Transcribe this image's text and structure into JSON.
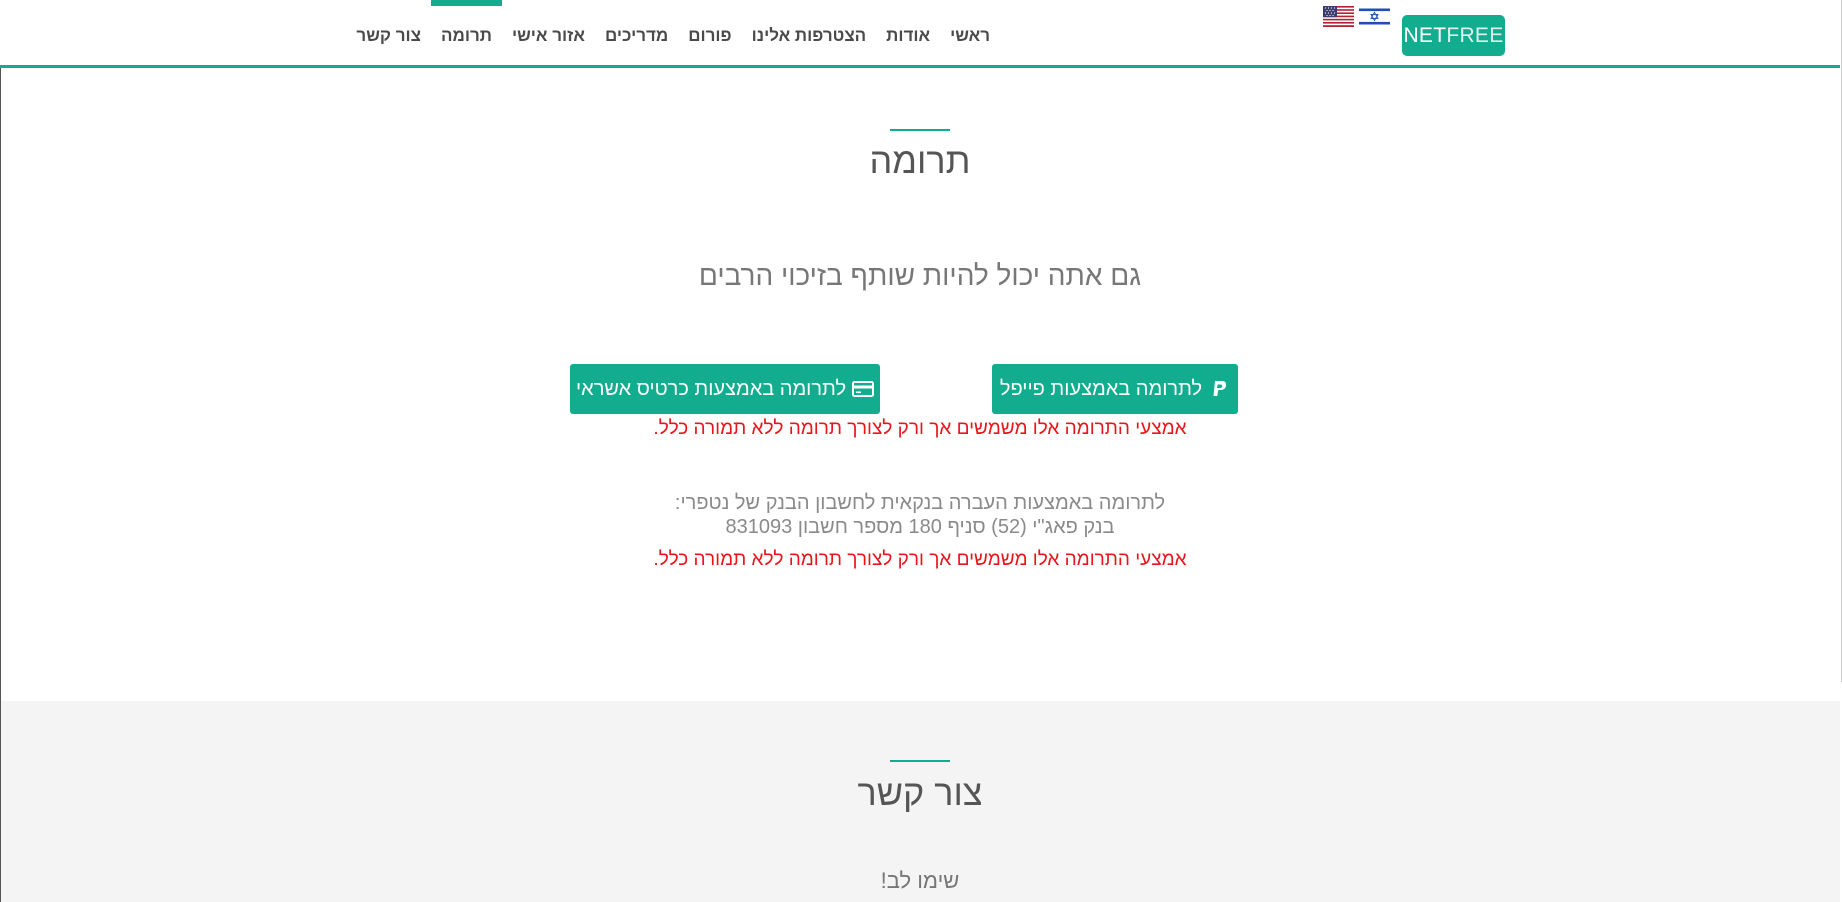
{
  "nav": {
    "items": [
      {
        "label": "ראשי",
        "active": false
      },
      {
        "label": "אודות",
        "active": false
      },
      {
        "label": "הצטרפות אלינו",
        "active": false
      },
      {
        "label": "פורום",
        "active": false
      },
      {
        "label": "מדריכים",
        "active": false
      },
      {
        "label": "אזור אישי",
        "active": false
      },
      {
        "label": "תרומה",
        "active": true
      },
      {
        "label": "צור קשר",
        "active": false
      }
    ]
  },
  "logo": {
    "part1": "NET",
    "part2": "FREE"
  },
  "languages": [
    {
      "name": "us-flag-icon"
    },
    {
      "name": "israel-flag-icon"
    }
  ],
  "donation": {
    "title": "תרומה",
    "subtitle": "גם אתה יכול להיות שותף בזיכוי הרבים",
    "paypal_button": "לתרומה באמצעות פייפל",
    "card_button": "לתרומה באמצעות כרטיס אשראי",
    "warning": "אמצעי התרומה אלו משמשים אך ורק לצורך תרומה ללא תמורה כלל.",
    "bank_intro": "לתרומה באמצעות העברה בנקאית לחשבון הבנק של נטפרי:",
    "bank_details": "בנק פאג\"י (52) סניף 180 מספר חשבון 831093",
    "bank_warning": "אמצעי התרומה אלו משמשים אך ורק לצורך תרומה ללא תמורה כלל."
  },
  "contact": {
    "title": "צור קשר",
    "notice": "שימו לב!"
  },
  "colors": {
    "accent": "#12ad8f",
    "warning": "#e8161b",
    "contact_background": "#f4f4f4"
  }
}
